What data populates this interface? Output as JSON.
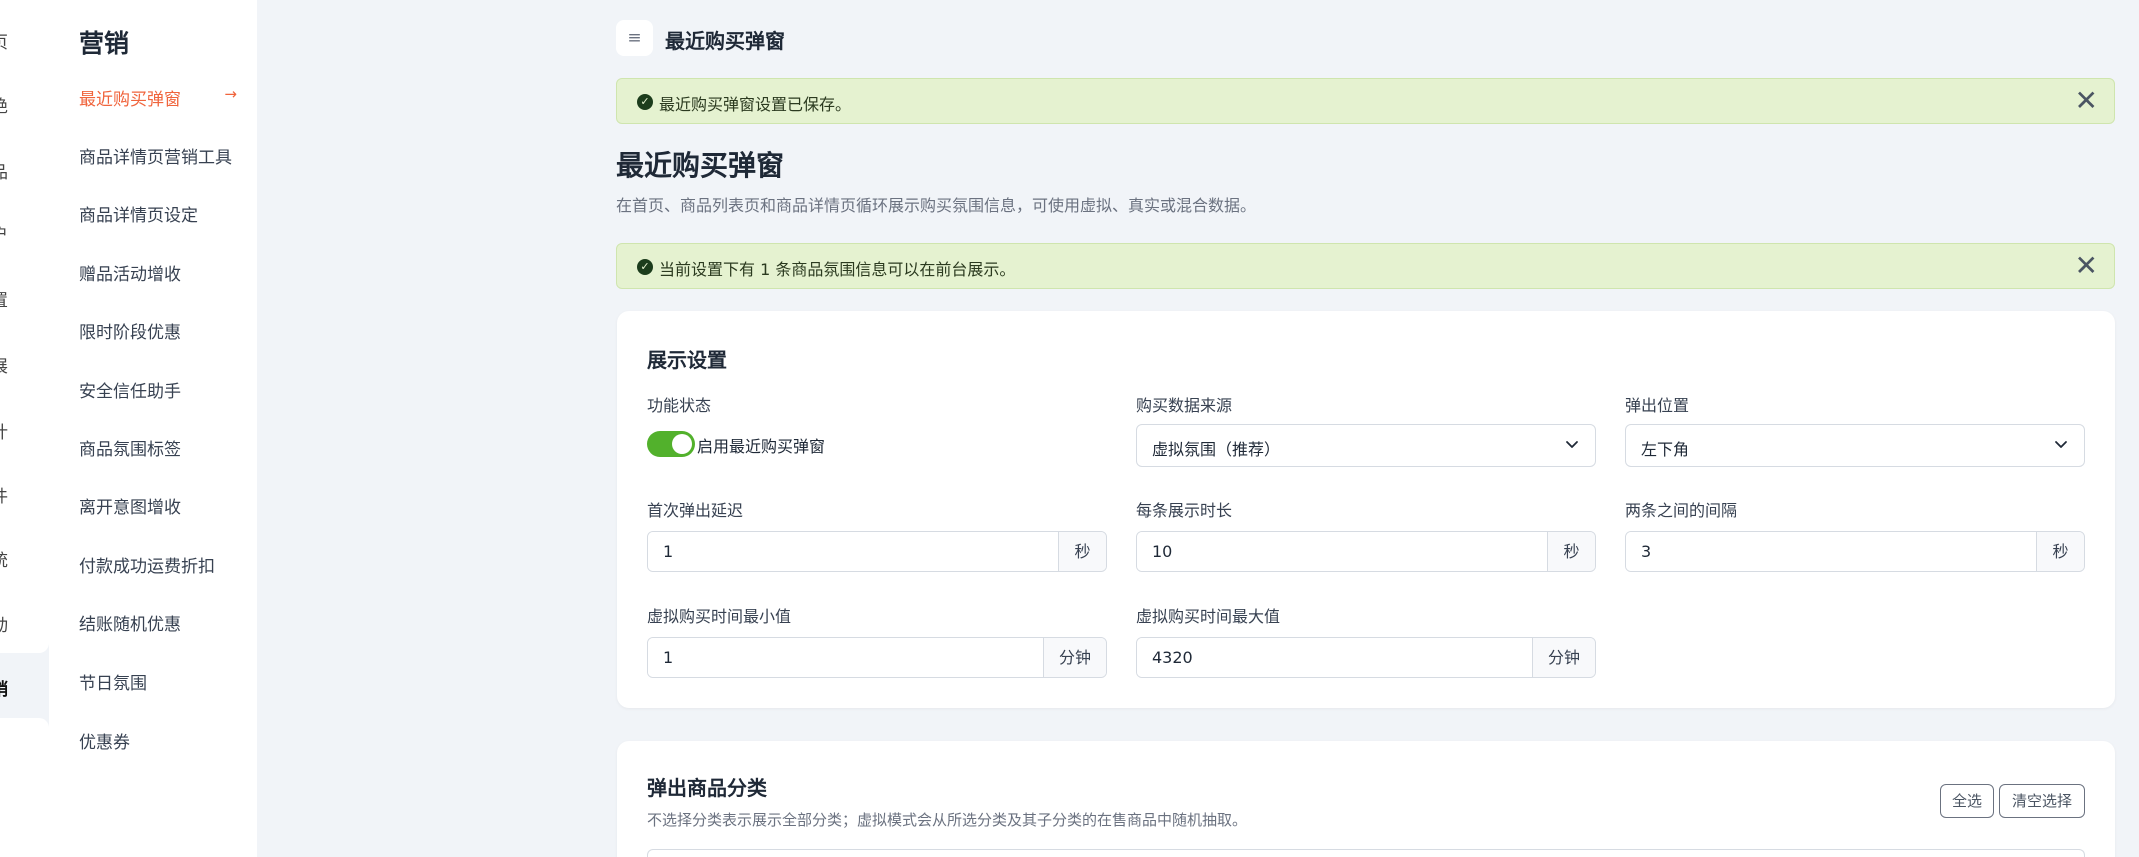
{
  "rail": {
    "items": [
      "页",
      "绝",
      "品",
      "户",
      "置",
      "展",
      "计",
      "件",
      "统",
      "动",
      "销"
    ],
    "active_label": "销"
  },
  "sidebar": {
    "title": "营销",
    "items": [
      {
        "label": "最近购买弹窗",
        "active": true
      },
      {
        "label": "商品详情页营销工具"
      },
      {
        "label": "商品详情页设定"
      },
      {
        "label": "赠品活动增收"
      },
      {
        "label": "限时阶段优惠"
      },
      {
        "label": "安全信任助手"
      },
      {
        "label": "商品氛围标签"
      },
      {
        "label": "离开意图增收"
      },
      {
        "label": "付款成功运费折扣"
      },
      {
        "label": "结账随机优惠"
      },
      {
        "label": "节日氛围"
      },
      {
        "label": "优惠券"
      }
    ],
    "active_arrow": "→"
  },
  "topbar": {
    "menu_icon": "≡",
    "title": "最近购买弹窗"
  },
  "alerts": {
    "saved": {
      "message": "最近购买弹窗设置已保存。",
      "close": "✕"
    },
    "info": {
      "message": "当前设置下有 1 条商品氛围信息可以在前台展示。",
      "close": "✕"
    }
  },
  "page": {
    "title": "最近购买弹窗",
    "description": "在首页、商品列表页和商品详情页循环展示购买氛围信息，可使用虚拟、真实或混合数据。"
  },
  "display_settings": {
    "title": "展示设置",
    "status": {
      "label": "功能状态",
      "toggle_label": "启用最近购买弹窗",
      "enabled": true
    },
    "data_source": {
      "label": "购买数据来源",
      "value": "虚拟氛围（推荐）"
    },
    "position": {
      "label": "弹出位置",
      "value": "左下角"
    },
    "first_delay": {
      "label": "首次弹出延迟",
      "value": "1",
      "unit": "秒"
    },
    "display_duration": {
      "label": "每条展示时长",
      "value": "10",
      "unit": "秒"
    },
    "interval": {
      "label": "两条之间的间隔",
      "value": "3",
      "unit": "秒"
    },
    "min_time": {
      "label": "虚拟购买时间最小值",
      "value": "1",
      "unit": "分钟"
    },
    "max_time": {
      "label": "虚拟购买时间最大值",
      "value": "4320",
      "unit": "分钟"
    }
  },
  "category_section": {
    "title": "弹出商品分类",
    "description": "不选择分类表示展示全部分类；虚拟模式会从所选分类及其子分类的在售商品中随机抽取。",
    "select_all": "全选",
    "clear": "清空选择"
  },
  "colors": {
    "accent": "#f0643c",
    "toggle_on": "#52b12c",
    "alert_bg": "#e5f2d0",
    "page_bg": "#f1f4f8"
  },
  "icons": {
    "ok": "✓",
    "chevron": "chevron-down-icon",
    "close": "close-icon",
    "menu": "menu-icon"
  }
}
